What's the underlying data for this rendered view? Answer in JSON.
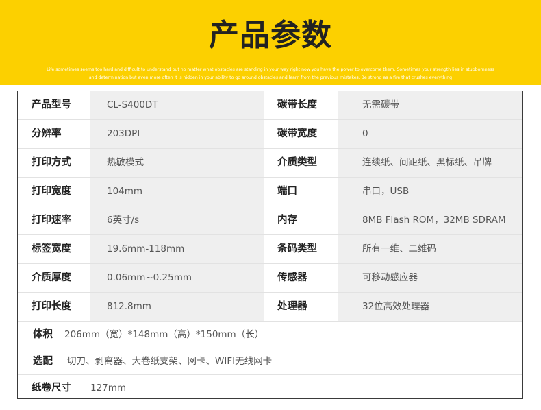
{
  "header": {
    "title": "产品参数",
    "subtitle_line1": "Life sometimes seems too hard and difficult to understand but no matter what obstacles are standing in your way right now you have the power to overcome them. Sometimes your strength lies in stubbornness",
    "subtitle_line2": "and determination but even more often it is hidden in your ability to go around obstacles and learn from the previous mistakes. Be strong as a fire that crushes everything"
  },
  "colors": {
    "banner": "#fcd000",
    "value_bg": "#efefef",
    "border": "#3a3a3a"
  },
  "specs": {
    "rows": [
      {
        "label_a": "产品型号",
        "value_a": "CL-S400DT",
        "label_b": "碳带长度",
        "value_b": "无需碳带"
      },
      {
        "label_a": "分辨率",
        "value_a": "203DPI",
        "label_b": "碳带宽度",
        "value_b": "0"
      },
      {
        "label_a": "打印方式",
        "value_a": "热敏模式",
        "label_b": "介质类型",
        "value_b": "连续纸、间距纸、黑标纸、吊牌"
      },
      {
        "label_a": "打印宽度",
        "value_a": "104mm",
        "label_b": "端口",
        "value_b": "串口，USB"
      },
      {
        "label_a": "打印速率",
        "value_a": "6英寸/s",
        "label_b": "内存",
        "value_b": "8MB Flash ROM，32MB SDRAM"
      },
      {
        "label_a": "标签宽度",
        "value_a": "19.6mm-118mm",
        "label_b": "条码类型",
        "value_b": "所有一维、二维码"
      },
      {
        "label_a": "介质厚度",
        "value_a": "0.06mm~0.25mm",
        "label_b": "传感器",
        "value_b": "可移动感应器"
      },
      {
        "label_a": "打印长度",
        "value_a": "812.8mm",
        "label_b": "处理器",
        "value_b": "32位高效处理器"
      }
    ],
    "volume": {
      "label": "体积",
      "value": "206mm（宽）*148mm（高）*150mm（长）"
    },
    "options": {
      "label": "选配",
      "value": "切刀、剥离器、大卷纸支架、网卡、WIFI无线网卡"
    },
    "roll": {
      "label": "纸卷尺寸",
      "value": "127mm"
    }
  }
}
